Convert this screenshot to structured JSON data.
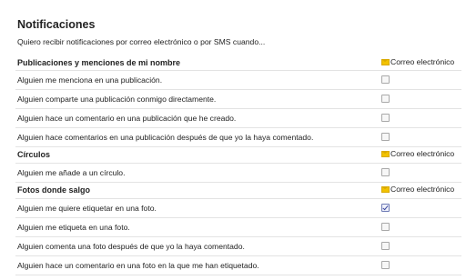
{
  "title": "Notificaciones",
  "intro": "Quiero recibir notificaciones por correo electrónico o por SMS cuando...",
  "email_column_label": "Correo electrónico",
  "sections": [
    {
      "heading": "Publicaciones y menciones de mi nombre",
      "items": [
        {
          "label": "Alguien me menciona en una publicación.",
          "checked": false
        },
        {
          "label": "Alguien comparte una publicación conmigo directamente.",
          "checked": false
        },
        {
          "label": "Alguien hace un comentario en una publicación que he creado.",
          "checked": false
        },
        {
          "label": "Alguien hace comentarios en una publicación después de que yo la haya comentado.",
          "checked": false
        }
      ]
    },
    {
      "heading": "Círculos",
      "items": [
        {
          "label": "Alguien me añade a un círculo.",
          "checked": false
        }
      ]
    },
    {
      "heading": "Fotos donde salgo",
      "items": [
        {
          "label": "Alguien me quiere etiquetar en una foto.",
          "checked": true
        },
        {
          "label": "Alguien me etiqueta en una foto.",
          "checked": false
        },
        {
          "label": "Alguien comenta una foto después de que yo la haya comentado.",
          "checked": false
        },
        {
          "label": "Alguien hace un comentario en una foto en la que me han etiquetado.",
          "checked": false
        }
      ]
    }
  ],
  "colors": {
    "mail_icon": "#f2c200",
    "checkbox_border": "#a8a8a8",
    "divider": "#e3e3e3"
  }
}
